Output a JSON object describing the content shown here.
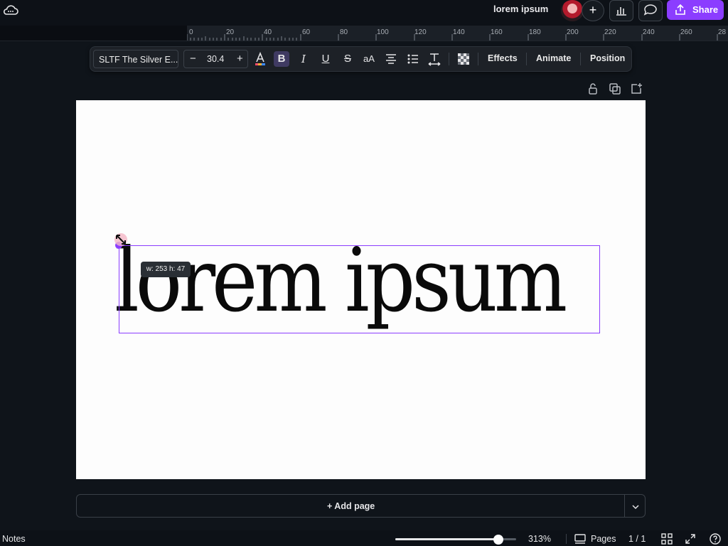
{
  "header": {
    "document_title": "lorem ipsum",
    "add_collaborator_label": "+",
    "share_label": "Share",
    "accent_color": "#8b3dff"
  },
  "ruler": {
    "ticks": [
      "0",
      "20",
      "40",
      "60",
      "80",
      "100",
      "120",
      "140",
      "160",
      "180",
      "200",
      "220",
      "240",
      "260",
      "28"
    ]
  },
  "text_toolbar": {
    "font_name": "SLTF The Silver E...",
    "font_size": "30.4",
    "decrease_label": "−",
    "increase_label": "+",
    "effects_label": "Effects",
    "animate_label": "Animate",
    "position_label": "Position",
    "icons": [
      "text-color-icon",
      "bold-icon",
      "italic-icon",
      "underline-icon",
      "strikethrough-icon",
      "letter-case-icon",
      "align-center-icon",
      "bullet-list-icon",
      "spacing-icon",
      "transparency-icon"
    ]
  },
  "page_tools": [
    "lock-icon",
    "duplicate-page-icon",
    "add-page-icon"
  ],
  "canvas": {
    "text_content": "lorem ipsum",
    "dimension_tooltip": "w: 253 h: 47"
  },
  "add_page_label": "+ Add page",
  "footer": {
    "notes_label": "Notes",
    "zoom_level": "313%",
    "zoom_fraction": 0.85,
    "pages_label": "Pages",
    "page_indicator": "1 / 1"
  }
}
